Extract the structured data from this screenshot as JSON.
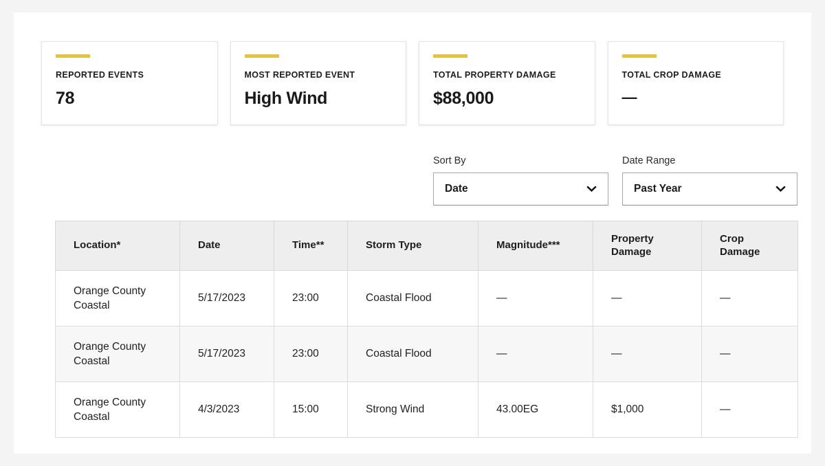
{
  "stats": [
    {
      "label": "REPORTED EVENTS",
      "value": "78",
      "accent": "#edc32a",
      "name": "reported-events"
    },
    {
      "label": "MOST REPORTED EVENT",
      "value": "High Wind",
      "accent": "#edc32a",
      "name": "most-reported-event"
    },
    {
      "label": "TOTAL PROPERTY DAMAGE",
      "value": "$88,000",
      "accent": "#edc32a",
      "name": "total-property-damage"
    },
    {
      "label": "TOTAL CROP DAMAGE",
      "value": "—",
      "accent": "#edc32a",
      "name": "total-crop-damage"
    }
  ],
  "controls": {
    "sort_by": {
      "label": "Sort By",
      "value": "Date",
      "icon": "chevron-down-icon"
    },
    "date_range": {
      "label": "Date Range",
      "value": "Past Year",
      "icon": "chevron-down-icon"
    }
  },
  "table": {
    "columns": [
      "Location*",
      "Date",
      "Time**",
      "Storm Type",
      "Property Damage",
      "Crop Damage",
      "Magnitude***"
    ],
    "headers": {
      "location": "Location*",
      "date": "Date",
      "time": "Time**",
      "storm_type": "Storm Type",
      "magnitude": "Magnitude***",
      "property_damage_line1": "Property",
      "property_damage_line2": "Damage",
      "crop_damage_line1": "Crop",
      "crop_damage_line2": "Damage"
    },
    "rows": [
      {
        "location": "Orange County Coastal",
        "date": "5/17/2023",
        "time": "23:00",
        "storm_type": "Coastal Flood",
        "magnitude": "—",
        "property_damage": "—",
        "crop_damage": "—"
      },
      {
        "location": "Orange County Coastal",
        "date": "5/17/2023",
        "time": "23:00",
        "storm_type": "Coastal Flood",
        "magnitude": "—",
        "property_damage": "—",
        "crop_damage": "—"
      },
      {
        "location": "Orange County Coastal",
        "date": "4/3/2023",
        "time": "15:00",
        "storm_type": "Strong Wind",
        "magnitude": "43.00EG",
        "property_damage": "$1,000",
        "crop_damage": "—"
      }
    ]
  },
  "colors": {
    "accent": "#edc32a",
    "page_background": "#f4f4f4",
    "card_background": "#ffffff",
    "table_header_background": "#eeeeee",
    "table_alt_row_background": "#f7f7f7",
    "text": "#1d1d1d"
  }
}
